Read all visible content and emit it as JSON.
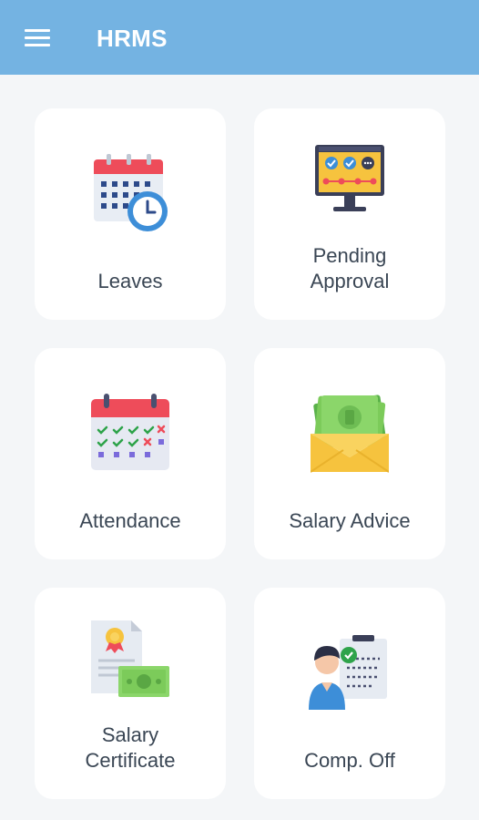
{
  "appbar": {
    "title": "HRMS",
    "menu_icon": "hamburger-menu-icon",
    "background": "#74b3e2"
  },
  "tiles": [
    {
      "label": "Leaves",
      "icon": "calendar-clock-icon"
    },
    {
      "label": "Pending\nApproval",
      "icon": "approval-monitor-icon"
    },
    {
      "label": "Attendance",
      "icon": "attendance-calendar-icon"
    },
    {
      "label": "Salary Advice",
      "icon": "money-envelope-icon"
    },
    {
      "label": "Salary\nCertificate",
      "icon": "certificate-money-icon"
    },
    {
      "label": "Comp. Off",
      "icon": "employee-checklist-icon"
    }
  ]
}
